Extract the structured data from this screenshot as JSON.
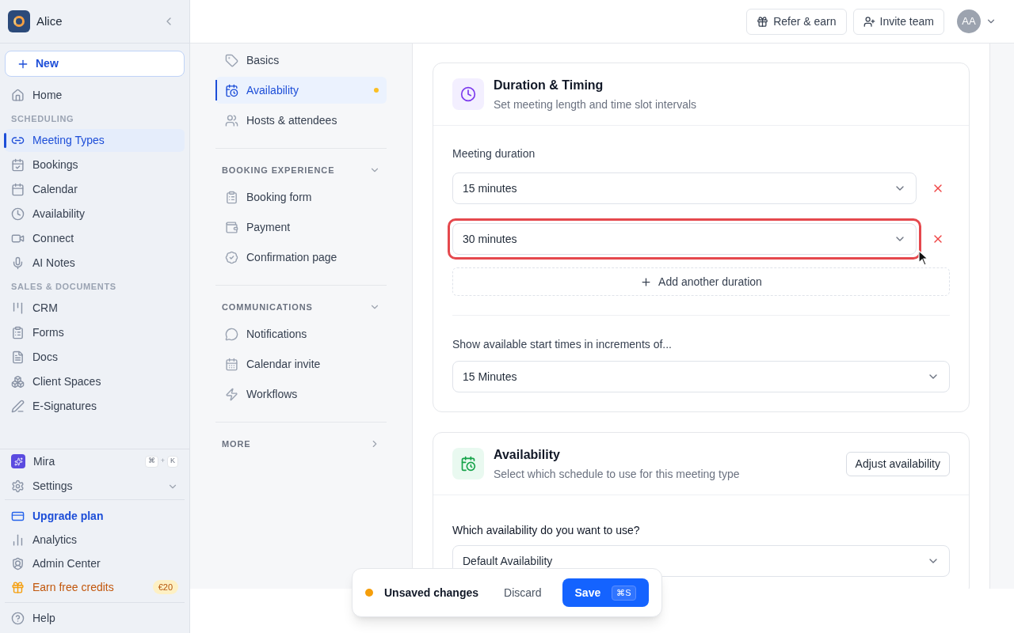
{
  "workspace": {
    "name": "Alice"
  },
  "new_button": {
    "label": "New"
  },
  "sidebar": {
    "groups": [
      {
        "items": [
          {
            "label": "Home",
            "selected": false
          }
        ]
      },
      {
        "heading": "SCHEDULING",
        "items": [
          {
            "label": "Meeting Types",
            "selected": true
          },
          {
            "label": "Bookings",
            "selected": false
          },
          {
            "label": "Calendar",
            "selected": false
          },
          {
            "label": "Availability",
            "selected": false
          },
          {
            "label": "Connect",
            "selected": false
          },
          {
            "label": "AI Notes",
            "selected": false
          }
        ]
      },
      {
        "heading": "SALES & DOCUMENTS",
        "items": [
          {
            "label": "CRM",
            "selected": false
          },
          {
            "label": "Forms",
            "selected": false
          },
          {
            "label": "Docs",
            "selected": false
          },
          {
            "label": "Client Spaces",
            "selected": false
          },
          {
            "label": "E-Signatures",
            "selected": false
          }
        ]
      }
    ]
  },
  "assistant": {
    "label": "Mira",
    "shortcut": [
      "⌘",
      "+",
      "K"
    ]
  },
  "settings": {
    "label": "Settings"
  },
  "bottom_links": [
    {
      "kind": "upgrade",
      "label": "Upgrade plan"
    },
    {
      "kind": "link",
      "label": "Analytics"
    },
    {
      "kind": "link",
      "label": "Admin Center"
    },
    {
      "kind": "promo",
      "label": "Earn free credits",
      "badge": "€20"
    }
  ],
  "help": {
    "label": "Help"
  },
  "top_bar": {
    "buttons": [
      "Refer & earn",
      "Invite team"
    ],
    "avatar": "AA"
  },
  "subnav": {
    "sections": [
      {
        "expanded": true,
        "items": [
          {
            "label": "Basics",
            "selected": false,
            "unsaved": false
          },
          {
            "label": "Availability",
            "selected": true,
            "unsaved": true
          },
          {
            "label": "Hosts & attendees",
            "selected": false,
            "unsaved": false
          }
        ]
      },
      {
        "heading": "BOOKING EXPERIENCE",
        "expanded": true,
        "items": [
          {
            "label": "Booking form",
            "selected": false,
            "unsaved": false
          },
          {
            "label": "Payment",
            "selected": false,
            "unsaved": false
          },
          {
            "label": "Confirmation page",
            "selected": false,
            "unsaved": false
          }
        ]
      },
      {
        "heading": "COMMUNICATIONS",
        "expanded": true,
        "items": [
          {
            "label": "Notifications",
            "selected": false,
            "unsaved": false
          },
          {
            "label": "Calendar invite",
            "selected": false,
            "unsaved": false
          },
          {
            "label": "Workflows",
            "selected": false,
            "unsaved": false
          }
        ]
      },
      {
        "heading": "MORE",
        "expanded": false
      }
    ]
  },
  "duration_card": {
    "title": "Duration & Timing",
    "subtitle": "Set meeting length and time slot intervals",
    "duration_label": "Meeting duration",
    "durations": [
      {
        "value": "15 minutes",
        "highlighted": false
      },
      {
        "value": "30 minutes",
        "highlighted": true
      }
    ],
    "add_button": "Add another duration",
    "increment_label": "Show available start times in increments of...",
    "increment_value": "15 Minutes"
  },
  "availability_card": {
    "title": "Availability",
    "subtitle": "Select which schedule to use for this meeting type",
    "button": "Adjust availability",
    "question": "Which availability do you want to use?",
    "value": "Default Availability"
  },
  "unsaved_bar": {
    "label": "Unsaved changes",
    "discard": "Discard",
    "save": "Save",
    "shortcut": "⌘S"
  }
}
